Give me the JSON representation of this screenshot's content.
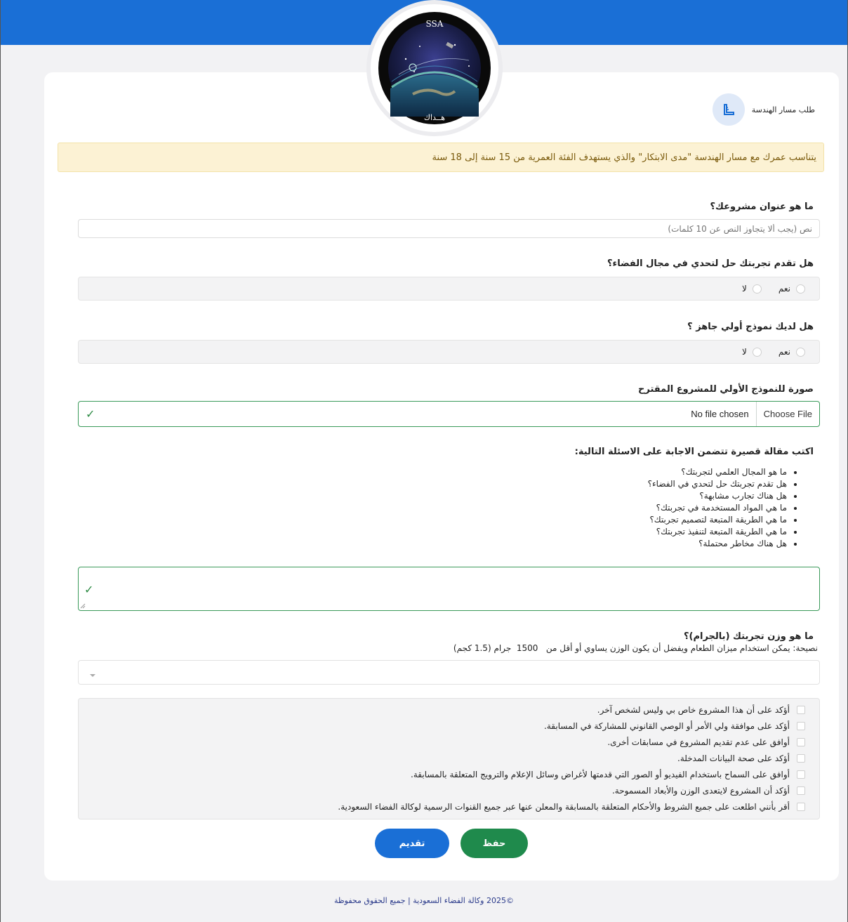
{
  "logo": {
    "text_top": "SSA",
    "text_bottom": "هــداك"
  },
  "header": {
    "title": "طلب مسار الهندسة",
    "icon": "ruler-triangle-icon"
  },
  "alert": {
    "text": "يتناسب عمرك مع مسار الهندسة \"مدى الابتكار\" والذي يستهدف الفئة العمرية من 15 سنة إلى 18 سنة"
  },
  "q_title": {
    "label": "ما هو عنوان مشروعك؟",
    "placeholder": "نص (يجب ألا يتجاوز النص عن 10 كلمات)"
  },
  "q_solution": {
    "label": "هل تقدم تجربتك حل لتحدي في مجال الفضاء؟",
    "yes": "نعم",
    "no": "لا"
  },
  "q_prototype": {
    "label": "هل لديك نموذج أولي جاهز ؟",
    "yes": "نعم",
    "no": "لا"
  },
  "q_image": {
    "label": "صورة للنموذج الأولي للمشروع المقترح",
    "button": "Choose File",
    "status": "No file chosen",
    "check": "✓"
  },
  "q_essay": {
    "label": "اكتب مقالة قصيرة تتضمن الاجابة على الاسئلة التالية:",
    "items": [
      "ما هو المجال العلمي لتجربتك؟",
      "هل تقدم تجربتك حل لتحدي في الفضاء؟",
      "هل هناك تجارب مشابهة؟",
      "ما هي المواد المستخدمة في تجربتك؟",
      "ما هي الطريقة المتبعة لتصميم تجربتك؟",
      "ما هي الطريقة المتبعة لتنفيذ تجربتك؟",
      "هل هناك مخاطر محتملة؟"
    ],
    "check": "✓"
  },
  "q_weight": {
    "label": "ما هو وزن تجربتك (بالجرام)؟",
    "hint": "نصيحة: يمكن استخدام ميزان الطعام ويفضل أن يكون الوزن يساوي أو أقل من   1500  جرام (1.5 كجم)"
  },
  "agreements": [
    "أؤكد على أن هذا المشروع خاص بي وليس لشخص آخر.",
    "أؤكد على موافقة ولي الأمر أو الوصي القانوني للمشاركة في المسابقة.",
    "أوافق على عدم تقديم المشروع في مسابقات أخرى.",
    "أؤكد على صحة البيانات المدخلة.",
    "أوافق على السماح باستخدام الفيديو أو الصور التي قدمتها لأغراض وسائل الإعلام والترويج المتعلقة بالمسابقة.",
    "أؤكد أن المشروع لايتعدى الوزن والأبعاد المسموحة.",
    "أقر بأنني اطلعت على جميع الشروط والأحكام المتعلقة بالمسابقة والمعلن عنها عبر جميع القنوات الرسمية لوكالة الفضاء السعودية."
  ],
  "buttons": {
    "submit": "تقديم",
    "save": "حفظ"
  },
  "colors": {
    "primary": "#1a6fd6",
    "success": "#1f8a4c",
    "alert_bg": "#fcf2d4"
  },
  "footer": {
    "text": "©2025 وكالة الفضاء السعودية | جميع الحقوق محفوظة"
  }
}
